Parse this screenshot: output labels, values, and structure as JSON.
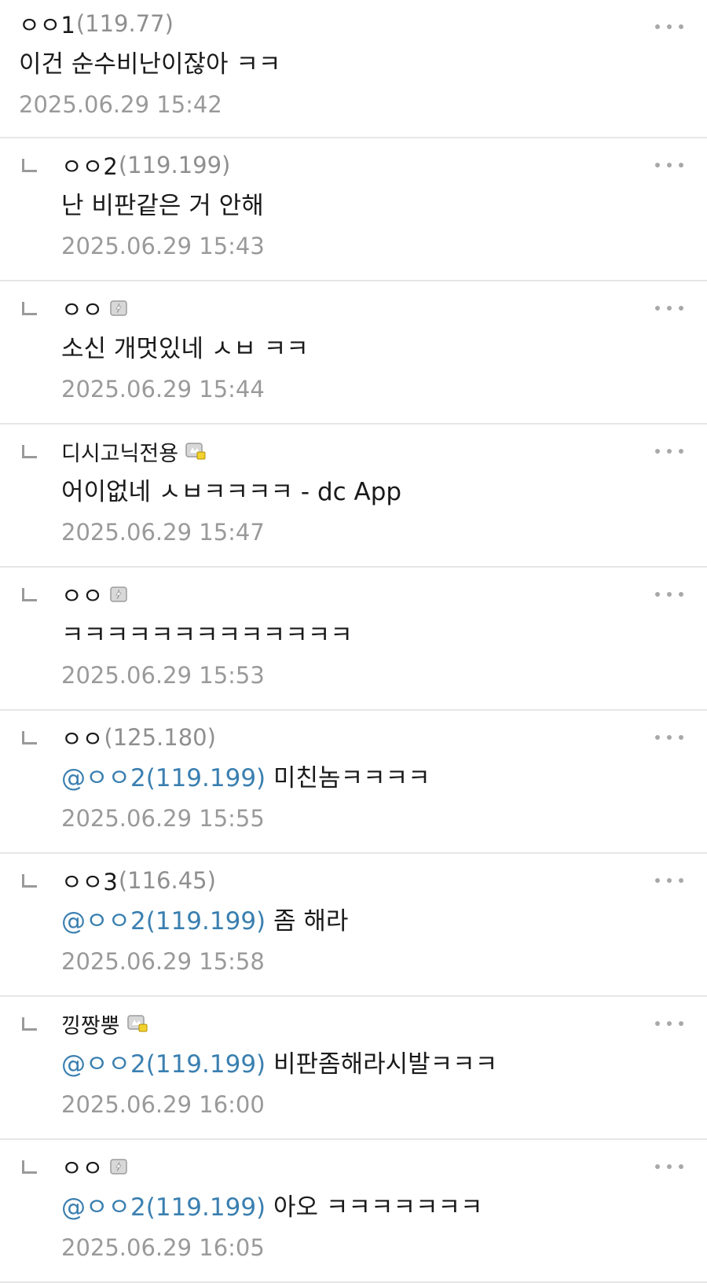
{
  "comments": [
    {
      "type": "top",
      "name": "ㅇㅇ1",
      "ip": "(119.77)",
      "badge": "",
      "mention": "",
      "text": "이건 순수비난이잖아 ㅋㅋ",
      "date": "2025.06.29 15:42"
    },
    {
      "type": "reply",
      "name": "ㅇㅇ2",
      "ip": "(119.199)",
      "badge": "",
      "mention": "",
      "text": "난 비판같은 거 안해",
      "date": "2025.06.29 15:43"
    },
    {
      "type": "reply",
      "name": "ㅇㅇ",
      "ip": "",
      "badge": "fixed-nick-icon",
      "mention": "",
      "text": "소신 개멋있네 ㅅㅂ ㅋㅋ",
      "date": "2025.06.29 15:44"
    },
    {
      "type": "reply",
      "name": "디시고닉전용",
      "ip": "",
      "badge": "gonick-icon",
      "mention": "",
      "text": "어이없네 ㅅㅂㅋㅋㅋㅋ - dc App",
      "date": "2025.06.29 15:47"
    },
    {
      "type": "reply",
      "name": "ㅇㅇ",
      "ip": "",
      "badge": "fixed-nick-icon",
      "mention": "",
      "text": "ㅋㅋㅋㅋㅋㅋㅋㅋㅋㅋㅋㅋㅋ",
      "date": "2025.06.29 15:53"
    },
    {
      "type": "reply",
      "name": "ㅇㅇ",
      "ip": "(125.180)",
      "badge": "",
      "mention": "@ㅇㅇ2(119.199)",
      "text": "미친놈ㅋㅋㅋㅋ",
      "date": "2025.06.29 15:55"
    },
    {
      "type": "reply",
      "name": "ㅇㅇ3",
      "ip": "(116.45)",
      "badge": "",
      "mention": "@ㅇㅇ2(119.199)",
      "text": "좀 해라",
      "date": "2025.06.29 15:58"
    },
    {
      "type": "reply",
      "name": "낑짱뿡",
      "ip": "",
      "badge": "gonick-icon",
      "mention": "@ㅇㅇ2(119.199)",
      "text": "비판좀해라시발ㅋㅋㅋ",
      "date": "2025.06.29 16:00"
    },
    {
      "type": "reply",
      "name": "ㅇㅇ",
      "ip": "",
      "badge": "fixed-nick-icon",
      "mention": "@ㅇㅇ2(119.199)",
      "text": "아오 ㅋㅋㅋㅋㅋㅋㅋ",
      "date": "2025.06.29 16:05"
    }
  ],
  "colors": {
    "mention": "#3a7fb0",
    "meta": "#9a9a9a",
    "divider": "#e6e6e6",
    "more_dots": "#a8a8a8"
  }
}
